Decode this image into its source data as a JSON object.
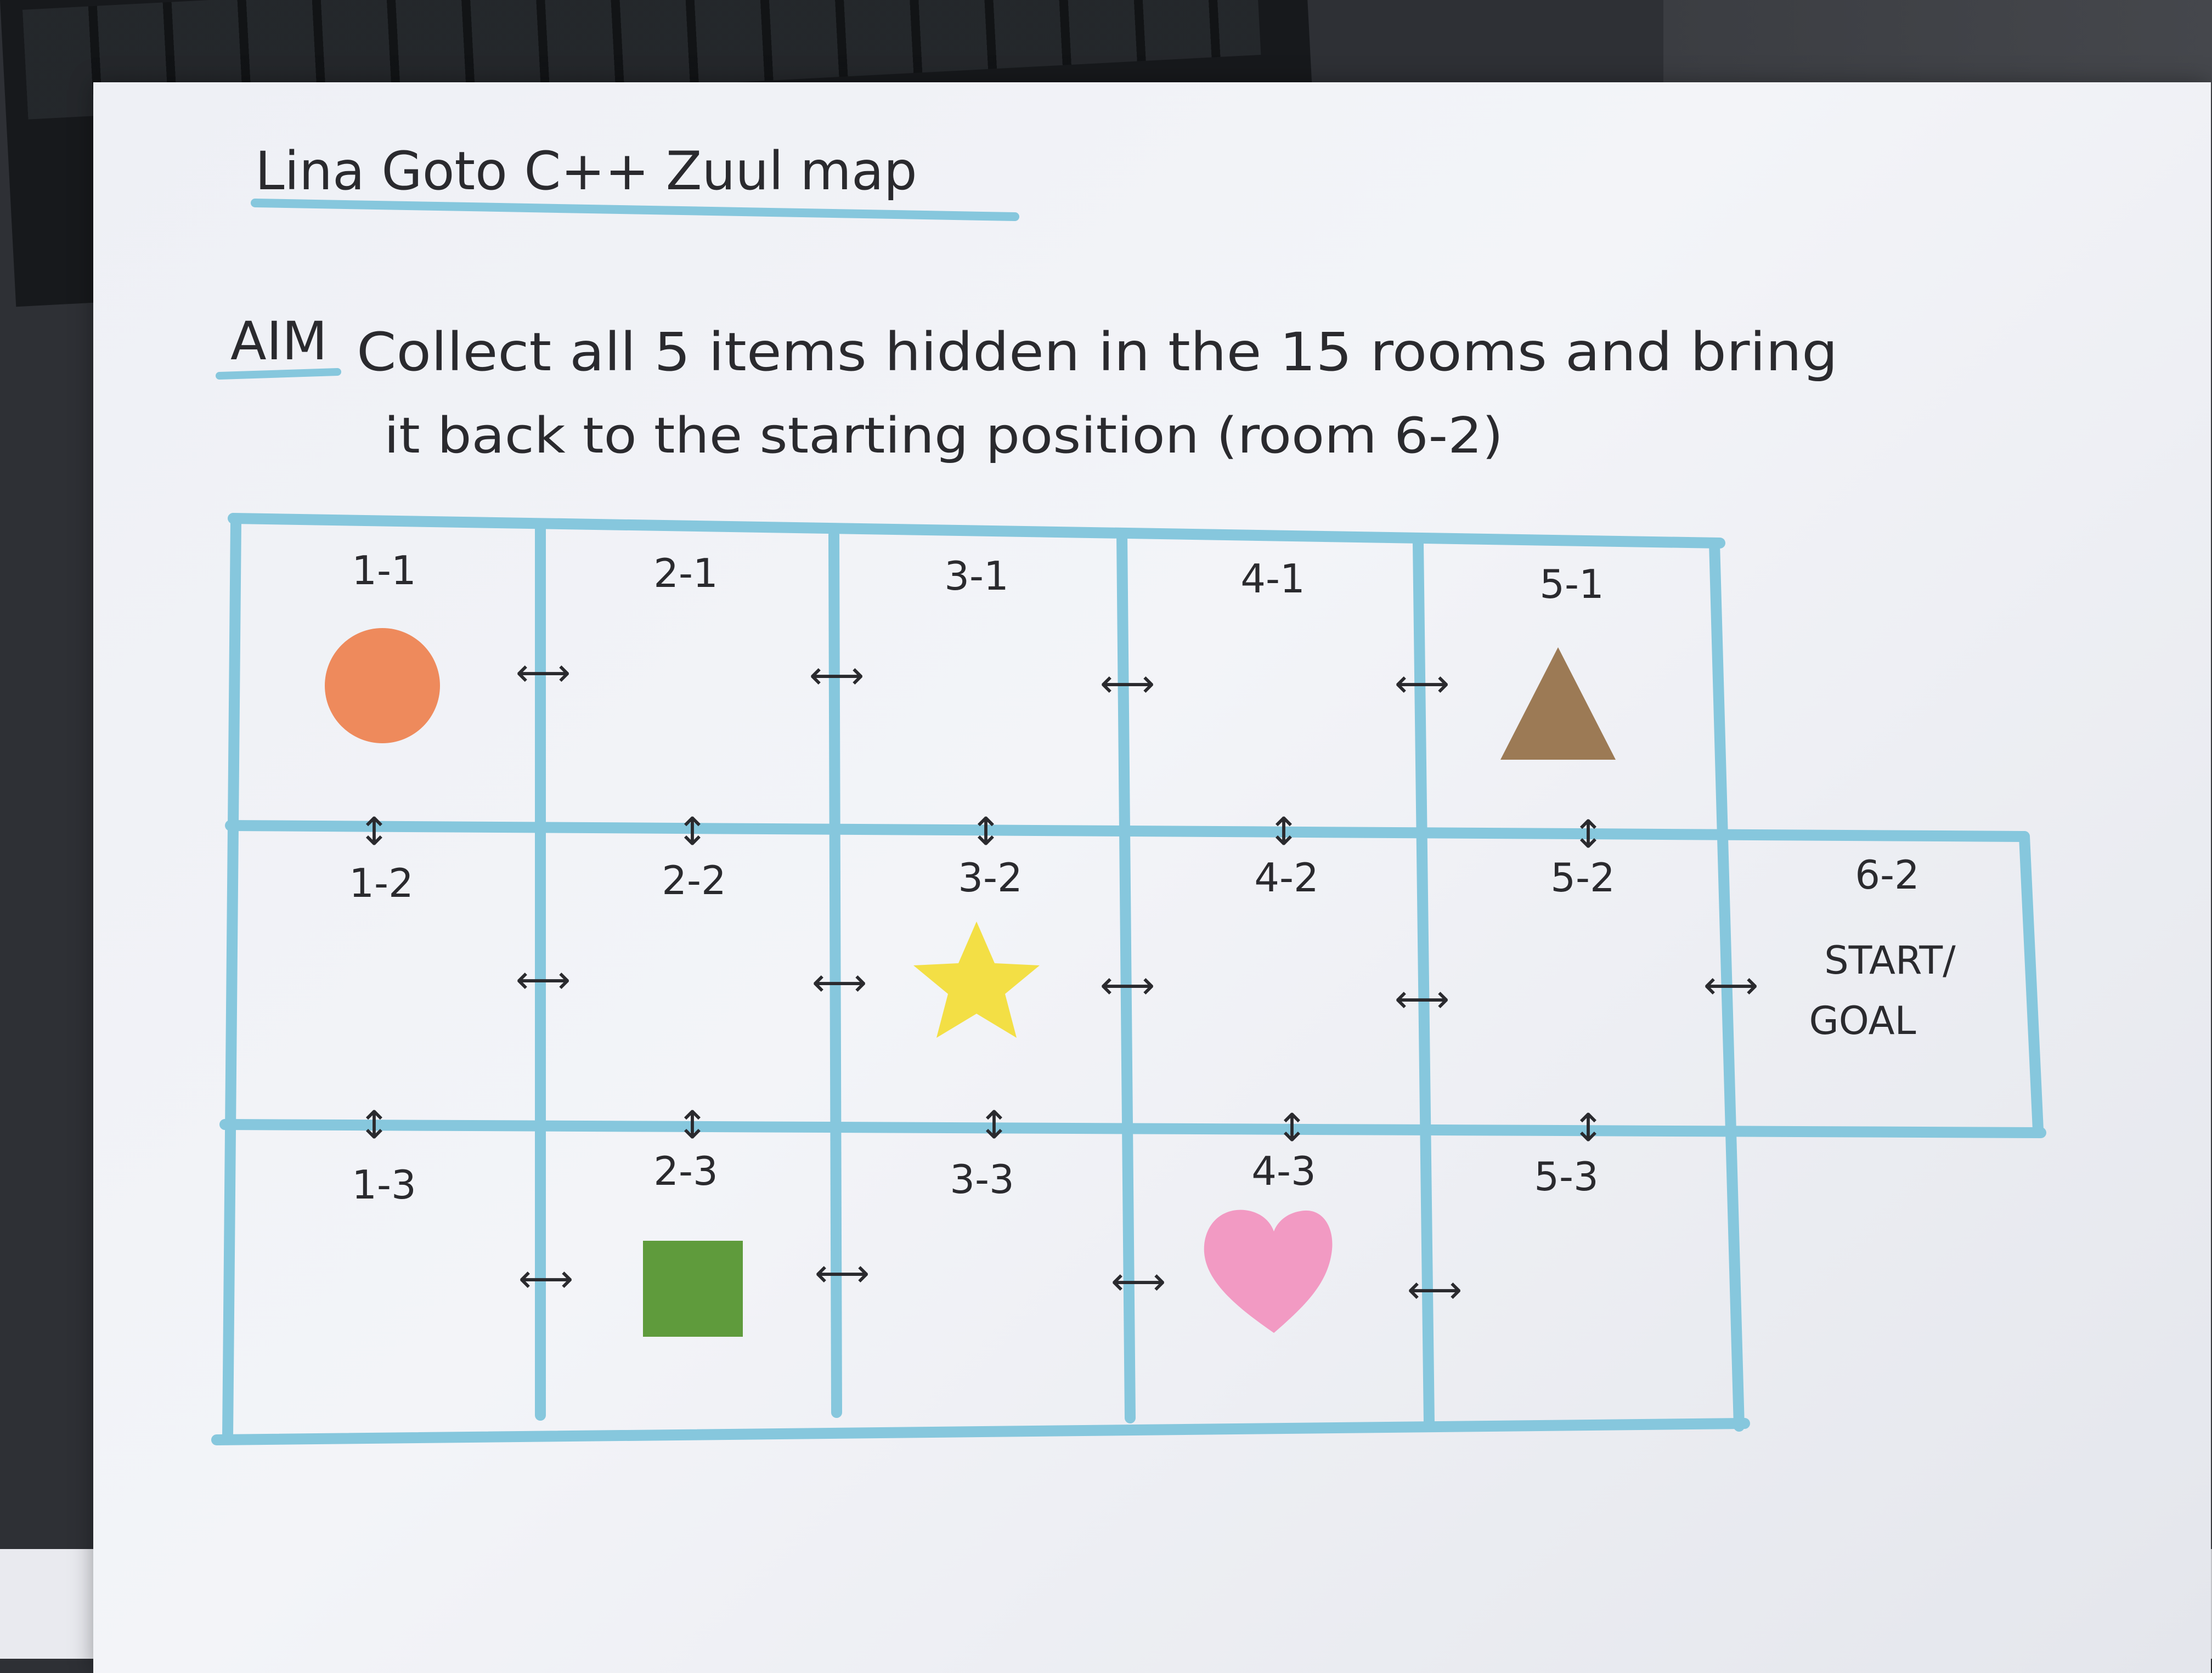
{
  "title": "Lina Goto   C++   Zuul map",
  "aim_label": "AIM",
  "aim_line1": "Collect all 5 items hidden in the 15 rooms and bring",
  "aim_line2": "it back to the starting position (room 6-2)",
  "colors": {
    "grid": "#86c7dd",
    "ink": "#2a2a2e",
    "circle": "#ee8a5c",
    "triangle": "#9c7a55",
    "star": "#f3df45",
    "square": "#5f9b3c",
    "heart": "#f29ac3"
  },
  "rooms": [
    {
      "id": "1-1",
      "item": "circle"
    },
    {
      "id": "2-1",
      "item": null
    },
    {
      "id": "3-1",
      "item": null
    },
    {
      "id": "4-1",
      "item": null
    },
    {
      "id": "5-1",
      "item": "triangle"
    },
    {
      "id": "1-2",
      "item": null
    },
    {
      "id": "2-2",
      "item": null
    },
    {
      "id": "3-2",
      "item": "star"
    },
    {
      "id": "4-2",
      "item": null
    },
    {
      "id": "5-2",
      "item": null
    },
    {
      "id": "6-2",
      "item": null,
      "note_line1": "START/",
      "note_line2": "GOAL"
    },
    {
      "id": "1-3",
      "item": null
    },
    {
      "id": "2-3",
      "item": "square"
    },
    {
      "id": "3-3",
      "item": null
    },
    {
      "id": "4-3",
      "item": "heart"
    },
    {
      "id": "5-3",
      "item": null
    }
  ],
  "arrows": {
    "horizontal": "⟷",
    "vertical": "↕"
  }
}
